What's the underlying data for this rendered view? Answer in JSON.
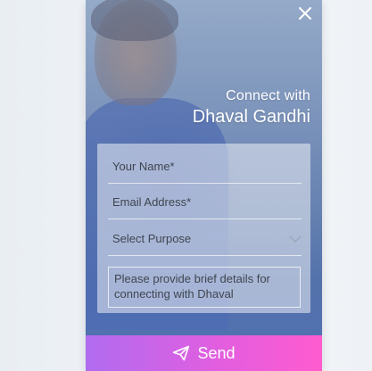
{
  "header": {
    "connect_with": "Connect with",
    "name": "Dhaval Gandhi"
  },
  "form": {
    "name_placeholder": "Your Name*",
    "email_placeholder": "Email Address*",
    "purpose_selected": "Select Purpose",
    "details_placeholder": "Please provide brief details for connecting with Dhaval"
  },
  "actions": {
    "send_label": "Send",
    "send_icon": "paper-plane-icon",
    "close_icon": "close-icon"
  },
  "colors": {
    "send_gradient_start": "#b06cf0",
    "send_gradient_end": "#ff5bcf",
    "text": "#3f4650"
  }
}
